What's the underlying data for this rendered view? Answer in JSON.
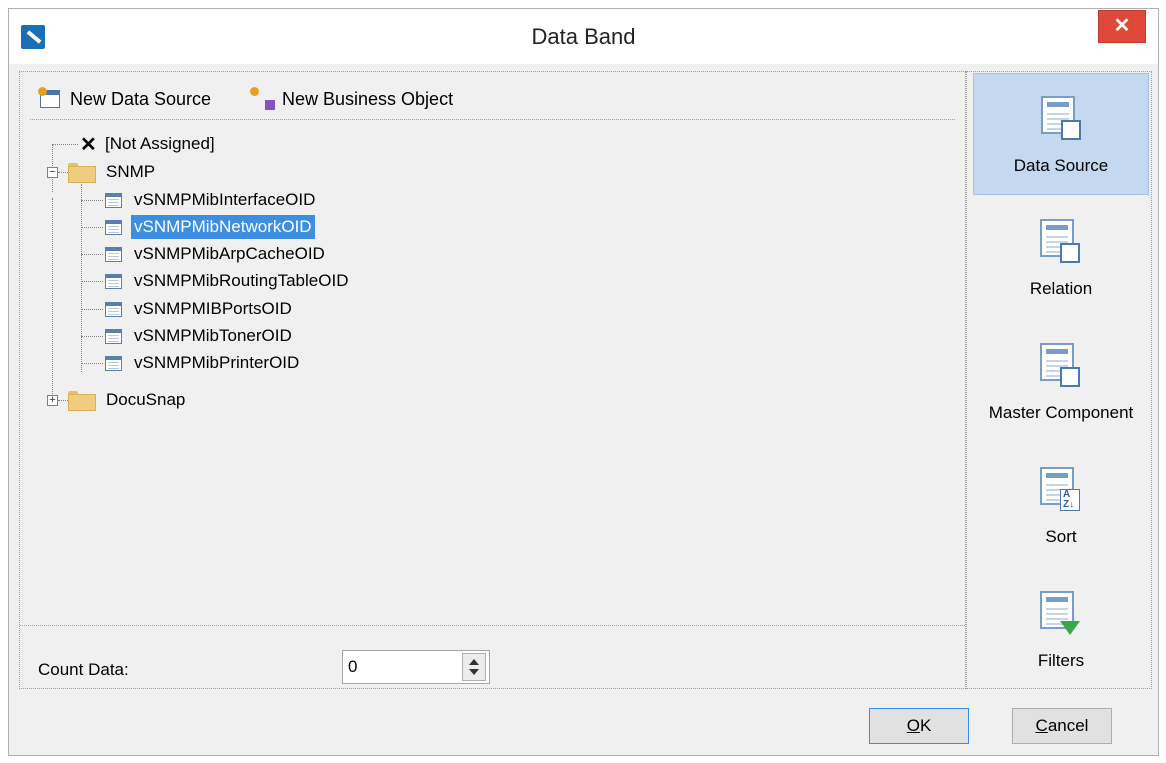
{
  "window": {
    "title": "Data Band",
    "close_label": "✕"
  },
  "toolbar": {
    "new_data_source": "New Data Source",
    "new_business_object": "New Business Object"
  },
  "tree": {
    "not_assigned": "[Not Assigned]",
    "snmp": {
      "label": "SNMP",
      "expanded": true,
      "children": [
        "vSNMPMibInterfaceOID",
        "vSNMPMibNetworkOID",
        "vSNMPMibArpCacheOID",
        "vSNMPMibRoutingTableOID",
        "vSNMPMIBPortsOID",
        "vSNMPMibTonerOID",
        "vSNMPMibPrinterOID"
      ],
      "selected_index": 1
    },
    "docusnap": {
      "label": "DocuSnap",
      "expanded": false
    }
  },
  "count": {
    "label": "Count Data:",
    "value": "0"
  },
  "nav": {
    "items": [
      {
        "label": "Data Source",
        "icon": "data-source-icon",
        "active": true
      },
      {
        "label": "Relation",
        "icon": "relation-icon",
        "active": false
      },
      {
        "label": "Master Component",
        "icon": "master-component-icon",
        "active": false
      },
      {
        "label": "Sort",
        "icon": "sort-icon",
        "active": false
      },
      {
        "label": "Filters",
        "icon": "filters-icon",
        "active": false
      }
    ]
  },
  "buttons": {
    "ok": "OK",
    "cancel": "Cancel"
  },
  "colors": {
    "selection": "#3c8ee0",
    "nav_active": "#c4d8f0",
    "close_button": "#e0483a"
  }
}
